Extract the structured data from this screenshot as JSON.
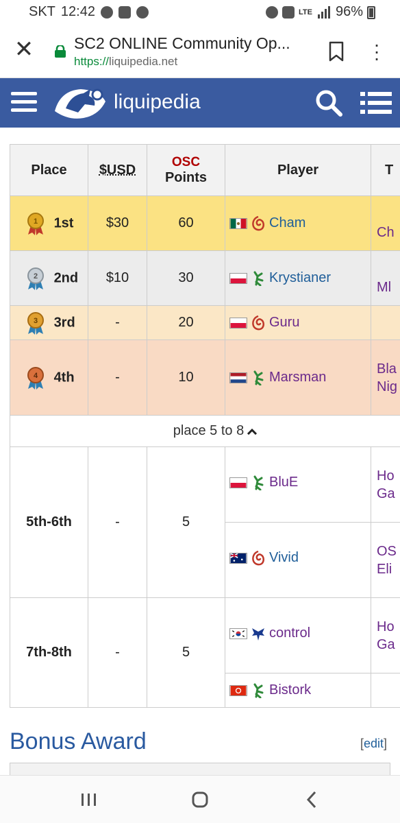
{
  "status_bar": {
    "carrier": "SKT",
    "time": "12:42",
    "network": "LTE",
    "battery": "96%"
  },
  "browser": {
    "title": "SC2 ONLINE Community Op...",
    "url_proto": "https://",
    "url_host": "liquipedia.net"
  },
  "site": {
    "brand": "liquipedia",
    "accent": "#3a5ba0"
  },
  "prize_table": {
    "headers": {
      "place": "Place",
      "usd": "$USD",
      "osc_top": "OSC",
      "osc_bottom": "Points",
      "player": "Player",
      "team": "T"
    },
    "rows": [
      {
        "place": "1st",
        "usd": "$30",
        "points": "60",
        "player": "Cham",
        "race": "zerg",
        "flag": "mexico",
        "team_line1": "",
        "team_line2": "Ch"
      },
      {
        "place": "2nd",
        "usd": "$10",
        "points": "30",
        "player": "Krystianer",
        "race": "protoss",
        "flag": "poland",
        "team_line1": "",
        "team_line2": "Ml"
      },
      {
        "place": "3rd",
        "usd": "-",
        "points": "20",
        "player": "Guru",
        "race": "zerg",
        "flag": "poland",
        "team_line1": "",
        "team_line2": ""
      },
      {
        "place": "4th",
        "usd": "-",
        "points": "10",
        "player": "Marsman",
        "race": "protoss",
        "flag": "netherlands",
        "team_line1": "Bla",
        "team_line2": "Nig"
      }
    ],
    "toggle_label": "place 5 to 8",
    "groups": [
      {
        "place": "5th-6th",
        "usd": "-",
        "points": "5",
        "players": [
          {
            "name": "BluE",
            "race": "protoss",
            "flag": "poland",
            "team_line1": "Ho",
            "team_line2": "Ga"
          },
          {
            "name": "Vivid",
            "race": "zerg",
            "flag": "australia",
            "team_line1": "OS",
            "team_line2": "Eli"
          }
        ]
      },
      {
        "place": "7th-8th",
        "usd": "-",
        "points": "5",
        "players": [
          {
            "name": "control",
            "race": "terran",
            "flag": "korea",
            "team_line1": "Ho",
            "team_line2": "Ga"
          },
          {
            "name": "Bistork",
            "race": "protoss",
            "flag": "hongkong",
            "team_line1": "",
            "team_line2": ""
          }
        ]
      }
    ]
  },
  "bonus": {
    "heading": "Bonus Award",
    "edit": "edit"
  }
}
